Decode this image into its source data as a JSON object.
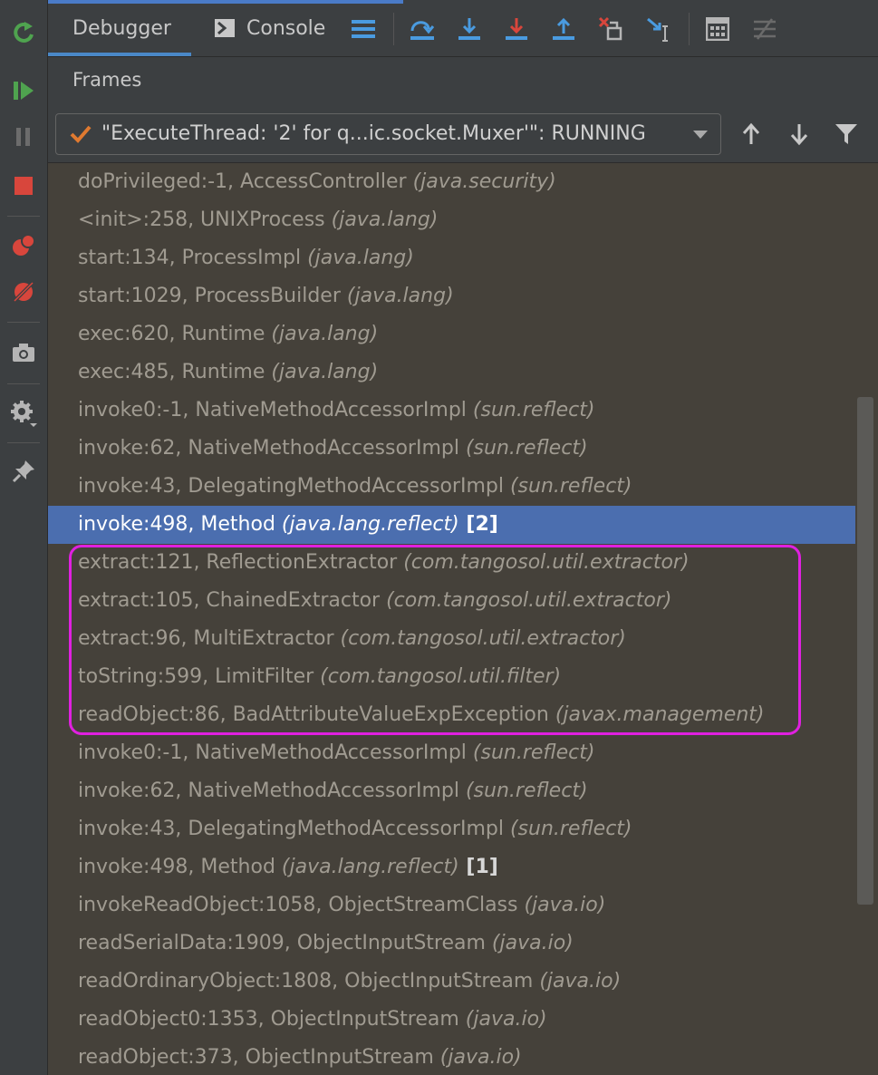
{
  "tabs": [
    {
      "label": "Debugger",
      "active": true
    },
    {
      "label": "Console",
      "active": false
    }
  ],
  "frames_header": "Frames",
  "thread": {
    "label": "\"ExecuteThread: '2' for q...ic.socket.Muxer'\": RUNNING"
  },
  "frames": [
    {
      "method": "doPrivileged:-1, AccessController ",
      "pkg": "(java.security)",
      "count": ""
    },
    {
      "method": "<init>:258, UNIXProcess ",
      "pkg": "(java.lang)",
      "count": ""
    },
    {
      "method": "start:134, ProcessImpl ",
      "pkg": "(java.lang)",
      "count": ""
    },
    {
      "method": "start:1029, ProcessBuilder ",
      "pkg": "(java.lang)",
      "count": ""
    },
    {
      "method": "exec:620, Runtime ",
      "pkg": "(java.lang)",
      "count": ""
    },
    {
      "method": "exec:485, Runtime ",
      "pkg": "(java.lang)",
      "count": ""
    },
    {
      "method": "invoke0:-1, NativeMethodAccessorImpl ",
      "pkg": "(sun.reflect)",
      "count": ""
    },
    {
      "method": "invoke:62, NativeMethodAccessorImpl ",
      "pkg": "(sun.reflect)",
      "count": ""
    },
    {
      "method": "invoke:43, DelegatingMethodAccessorImpl ",
      "pkg": "(sun.reflect)",
      "count": ""
    },
    {
      "method": "invoke:498, Method ",
      "pkg": "(java.lang.reflect)",
      "count": " [2]",
      "selected": true
    },
    {
      "method": "extract:121, ReflectionExtractor ",
      "pkg": "(com.tangosol.util.extractor)",
      "count": ""
    },
    {
      "method": "extract:105, ChainedExtractor ",
      "pkg": "(com.tangosol.util.extractor)",
      "count": ""
    },
    {
      "method": "extract:96, MultiExtractor ",
      "pkg": "(com.tangosol.util.extractor)",
      "count": ""
    },
    {
      "method": "toString:599, LimitFilter ",
      "pkg": "(com.tangosol.util.filter)",
      "count": ""
    },
    {
      "method": "readObject:86, BadAttributeValueExpException ",
      "pkg": "(javax.management)",
      "count": ""
    },
    {
      "method": "invoke0:-1, NativeMethodAccessorImpl ",
      "pkg": "(sun.reflect)",
      "count": ""
    },
    {
      "method": "invoke:62, NativeMethodAccessorImpl ",
      "pkg": "(sun.reflect)",
      "count": ""
    },
    {
      "method": "invoke:43, DelegatingMethodAccessorImpl ",
      "pkg": "(sun.reflect)",
      "count": ""
    },
    {
      "method": "invoke:498, Method ",
      "pkg": "(java.lang.reflect)",
      "count": " [1]"
    },
    {
      "method": "invokeReadObject:1058, ObjectStreamClass ",
      "pkg": "(java.io)",
      "count": ""
    },
    {
      "method": "readSerialData:1909, ObjectInputStream ",
      "pkg": "(java.io)",
      "count": ""
    },
    {
      "method": "readOrdinaryObject:1808, ObjectInputStream ",
      "pkg": "(java.io)",
      "count": ""
    },
    {
      "method": "readObject0:1353, ObjectInputStream ",
      "pkg": "(java.io)",
      "count": ""
    },
    {
      "method": "readObject:373, ObjectInputStream ",
      "pkg": "(java.io)",
      "count": ""
    }
  ],
  "colors": {
    "selection": "#4b6eaf",
    "highlight_box": "#e020e0",
    "rerun": "#4fa34f",
    "stop": "#d8463c"
  }
}
